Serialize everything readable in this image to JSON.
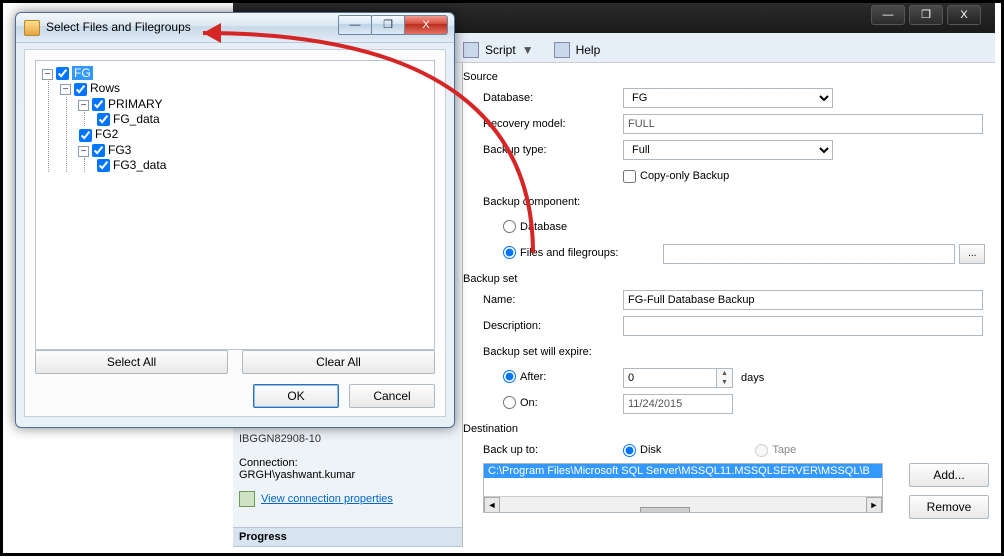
{
  "bg": {
    "min": "—",
    "max": "❐",
    "close": "X"
  },
  "toolbar": {
    "script": "Script",
    "help": "Help"
  },
  "source": {
    "heading": "Source",
    "database_label": "Database:",
    "database_value": "FG",
    "recovery_label": "Recovery model:",
    "recovery_value": "FULL",
    "type_label": "Backup type:",
    "type_value": "Full",
    "copyonly": "Copy-only Backup",
    "component_label": "Backup component:",
    "comp_db": "Database",
    "comp_files": "Files and filegroups:",
    "browse": "..."
  },
  "backupset": {
    "heading": "Backup set",
    "name_label": "Name:",
    "name_value": "FG-Full Database Backup",
    "desc_label": "Description:",
    "desc_value": "",
    "expire_label": "Backup set will expire:",
    "after": "After:",
    "after_value": "0",
    "days": "days",
    "on": "On:",
    "on_value": "11/24/2015"
  },
  "destination": {
    "heading": "Destination",
    "backup_to": "Back up to:",
    "disk": "Disk",
    "tape": "Tape",
    "path": "C:\\Program Files\\Microsoft SQL Server\\MSSQL11.MSSQLSERVER\\MSSQL\\B",
    "add": "Add...",
    "remove": "Remove"
  },
  "leftpanel": {
    "server_code": "IBGGN82908-10",
    "conn_label": "Connection:",
    "conn_value": "GRGH\\yashwant.kumar",
    "view_conn": "View connection properties",
    "progress": "Progress"
  },
  "dialog": {
    "title": "Select Files and Filegroups",
    "select_all": "Select All",
    "clear_all": "Clear All",
    "ok": "OK",
    "cancel": "Cancel",
    "tree": {
      "root": "FG",
      "rows": "Rows",
      "primary": "PRIMARY",
      "fg_data": "FG_data",
      "fg2": "FG2",
      "fg3": "FG3",
      "fg3_data": "FG3_data"
    }
  }
}
